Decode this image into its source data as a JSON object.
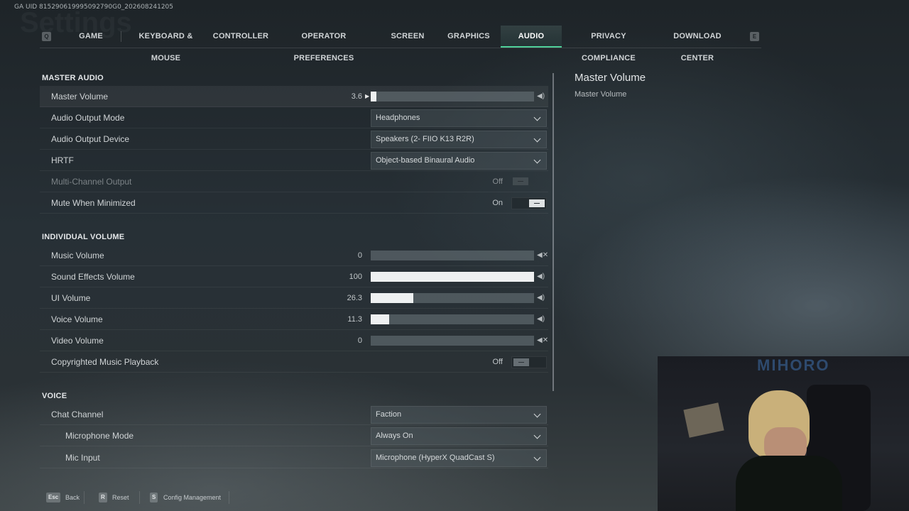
{
  "uid": "GA UID 815290619995092790G0_202608241205",
  "background_title": "Settings",
  "tabs": {
    "left_key": "Q",
    "right_key": "E",
    "items": [
      {
        "label": "GAME"
      },
      {
        "label": "KEYBOARD & MOUSE"
      },
      {
        "label": "CONTROLLER"
      },
      {
        "label": "OPERATOR PREFERENCES"
      },
      {
        "label": "SCREEN"
      },
      {
        "label": "GRAPHICS"
      },
      {
        "label": "AUDIO",
        "active": true
      },
      {
        "label": "PRIVACY COMPLIANCE"
      },
      {
        "label": "DOWNLOAD CENTER"
      }
    ]
  },
  "master_audio": {
    "title": "MASTER AUDIO",
    "master_volume": {
      "label": "Master Volume",
      "value": "3.6",
      "level": 0.036
    },
    "output_mode": {
      "label": "Audio Output Mode",
      "value": "Headphones"
    },
    "output_device": {
      "label": "Audio Output Device",
      "value": "Speakers (2- FIIO K13 R2R)"
    },
    "hrtf": {
      "label": "HRTF",
      "value": "Object-based Binaural Audio"
    },
    "multi_channel": {
      "label": "Multi-Channel Output",
      "value": "Off"
    },
    "mute_minimized": {
      "label": "Mute When Minimized",
      "value": "On"
    }
  },
  "individual_volume": {
    "title": "INDIVIDUAL VOLUME",
    "music": {
      "label": "Music Volume",
      "value": "0",
      "level": 0
    },
    "sfx": {
      "label": "Sound Effects Volume",
      "value": "100",
      "level": 1.0
    },
    "ui": {
      "label": "UI Volume",
      "value": "26.3",
      "level": 0.263
    },
    "voice": {
      "label": "Voice Volume",
      "value": "11.3",
      "level": 0.113
    },
    "video": {
      "label": "Video Volume",
      "value": "0",
      "level": 0
    },
    "copyrighted": {
      "label": "Copyrighted Music Playback",
      "value": "Off"
    }
  },
  "voice": {
    "title": "VOICE",
    "chat_channel": {
      "label": "Chat Channel",
      "value": "Faction"
    },
    "mic_mode": {
      "label": "Microphone Mode",
      "value": "Always On"
    },
    "mic_input": {
      "label": "Mic Input",
      "value": "Microphone (HyperX QuadCast S)"
    }
  },
  "description": {
    "title": "Master Volume",
    "text": "Master Volume"
  },
  "webcam": {
    "sign": "MIHORO"
  },
  "footer": {
    "back": {
      "key": "Esc",
      "label": "Back"
    },
    "reset": {
      "key": "R",
      "label": "Reset"
    },
    "config": {
      "key": "S",
      "label": "Config Management"
    }
  }
}
